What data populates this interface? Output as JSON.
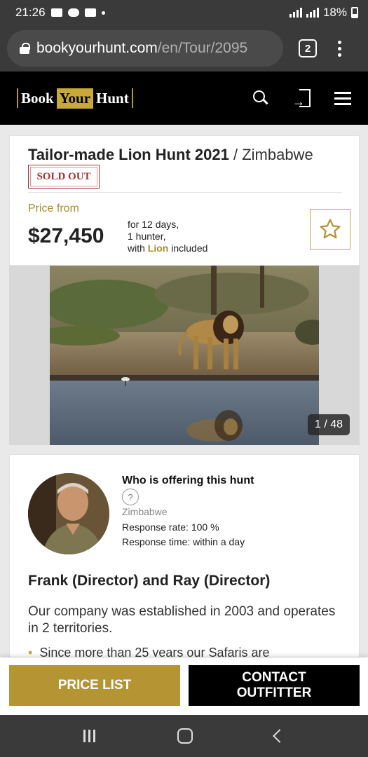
{
  "status_bar": {
    "time": "21:26",
    "battery": "18%"
  },
  "browser": {
    "url_host": "bookyourhunt.com",
    "url_path": "/en/Tour/2095",
    "tab_count": "2"
  },
  "site": {
    "logo_word1": "Book",
    "logo_word2": "Your",
    "logo_word3": "Hunt"
  },
  "tour": {
    "title": "Tailor-made Lion Hunt 2021",
    "location": " / Zimbabwe",
    "status_badge": "SOLD OUT",
    "price_label": "Price from",
    "price": "$27,450",
    "detail_days": "for 12 days,",
    "detail_hunters": "1 hunter,",
    "detail_with": "with ",
    "detail_species": "Lion",
    "detail_included": " included"
  },
  "gallery": {
    "counter": "1 / 48"
  },
  "outfitter": {
    "heading": "Who is offering this hunt",
    "help": "?",
    "country": "Zimbabwe",
    "response_rate": "Response rate: 100 %",
    "response_time": "Response time: within a day",
    "names": "Frank (Director) and Ray (Director)",
    "description": "Our company was established in 2003 and operates in 2 territories.",
    "bullet": "Since more than 25 years our Safaris are"
  },
  "actions": {
    "price_list": "PRICE LIST",
    "contact_line1": "CONTACT",
    "contact_line2": "OUTFITTER"
  },
  "colors": {
    "gold": "#b59433",
    "sold_out_red": "#a33333",
    "header_black": "#000000"
  }
}
